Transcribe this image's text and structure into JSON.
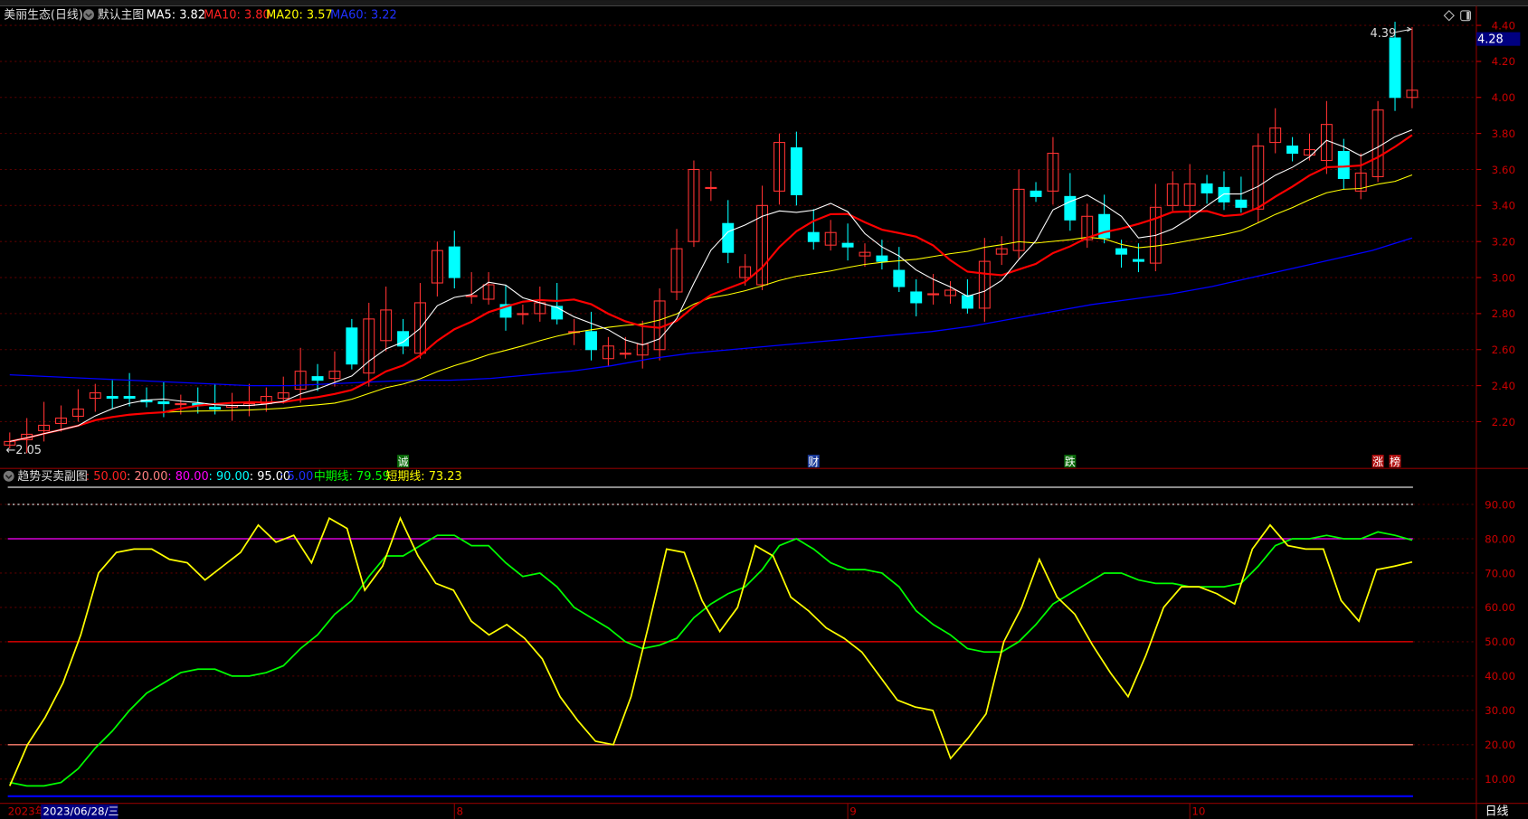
{
  "header": {
    "stock_name": "美丽生态(日线)",
    "main_chart_label": "默认主图",
    "ma5": "MA5: 3.82",
    "ma10": "MA10: 3.80",
    "ma20": "MA20: 3.57",
    "ma60": "MA60: 3.22"
  },
  "sub_header": {
    "label": "趋势买卖副图",
    "p1": ": 50.00",
    "p2": ": 20.00",
    "p3": ": 80.00",
    "p4": ": 90.00",
    "p5": ": 95.00",
    "p6": ": 5.00",
    "mid": "中期线: 79.59",
    "short": "短期线: 73.23"
  },
  "colors": {
    "up": "#ff3232",
    "down": "#00ffff",
    "ma5": "#ffffff",
    "ma10": "#ff0000",
    "ma20": "#ffff00",
    "ma60": "#0000ff",
    "mid": "#00ff00",
    "short": "#ffff00"
  },
  "price_axis": [
    "4.40",
    "4.20",
    "4.00",
    "3.80",
    "3.60",
    "3.40",
    "3.20",
    "3.00",
    "2.80",
    "2.60",
    "2.40",
    "2.20"
  ],
  "current_price": "4.28",
  "high_label": "4.39",
  "low_label": "←2.05",
  "sub_axis": [
    "90.00",
    "80.00",
    "70.00",
    "60.00",
    "50.00",
    "40.00",
    "30.00",
    "20.00",
    "10.00"
  ],
  "markers": [
    {
      "i": 23,
      "t": "诚",
      "bg": "#0a6b0a"
    },
    {
      "i": 47,
      "t": "财",
      "bg": "#1a3a9a"
    },
    {
      "i": 62,
      "t": "跌",
      "bg": "#0a6b0a"
    },
    {
      "i": 80,
      "t": "涨",
      "bg": "#b01010"
    },
    {
      "i": 81,
      "t": "榜",
      "bg": "#b01010"
    }
  ],
  "date_axis": {
    "year": "2023年",
    "selected": "2023/06/28/三",
    "months": [
      {
        "i": 26,
        "t": "8"
      },
      {
        "i": 49,
        "t": "9"
      },
      {
        "i": 69,
        "t": "10"
      }
    ],
    "period": "日线"
  },
  "chart_data": {
    "type": "candlestick",
    "price_range": [
      2.0,
      4.45
    ],
    "candles": [
      [
        2.07,
        2.09
      ],
      [
        2.1,
        2.13
      ],
      [
        2.15,
        2.18
      ],
      [
        2.19,
        2.22
      ],
      [
        2.23,
        2.27
      ],
      [
        2.33,
        2.36
      ],
      [
        2.34,
        2.33
      ],
      [
        2.34,
        2.33
      ],
      [
        2.32,
        2.31
      ],
      [
        2.31,
        2.3
      ],
      [
        2.3,
        2.3
      ],
      [
        2.3,
        2.29
      ],
      [
        2.28,
        2.27
      ],
      [
        2.28,
        2.29
      ],
      [
        2.29,
        2.3
      ],
      [
        2.3,
        2.34
      ],
      [
        2.33,
        2.36
      ],
      [
        2.38,
        2.48
      ],
      [
        2.45,
        2.43
      ],
      [
        2.44,
        2.48
      ],
      [
        2.72,
        2.52
      ],
      [
        2.47,
        2.77
      ],
      [
        2.65,
        2.82
      ],
      [
        2.7,
        2.62
      ],
      [
        2.58,
        2.86
      ],
      [
        2.97,
        3.15
      ],
      [
        3.17,
        3.0
      ],
      [
        2.9,
        2.9
      ],
      [
        2.88,
        2.96
      ],
      [
        2.85,
        2.78
      ],
      [
        2.8,
        2.8
      ],
      [
        2.8,
        2.86
      ],
      [
        2.84,
        2.77
      ],
      [
        2.7,
        2.7
      ],
      [
        2.7,
        2.6
      ],
      [
        2.55,
        2.62
      ],
      [
        2.58,
        2.58
      ],
      [
        2.57,
        2.63
      ],
      [
        2.6,
        2.87
      ],
      [
        2.92,
        3.16
      ],
      [
        3.2,
        3.6
      ],
      [
        3.5,
        3.5
      ],
      [
        3.3,
        3.14
      ],
      [
        3.0,
        3.06
      ],
      [
        2.96,
        3.4
      ],
      [
        3.48,
        3.75
      ],
      [
        3.72,
        3.46
      ],
      [
        3.25,
        3.2
      ],
      [
        3.18,
        3.25
      ],
      [
        3.19,
        3.17
      ],
      [
        3.12,
        3.14
      ],
      [
        3.12,
        3.09
      ],
      [
        3.04,
        2.95
      ],
      [
        2.92,
        2.86
      ],
      [
        2.91,
        2.91
      ],
      [
        2.9,
        2.93
      ],
      [
        2.9,
        2.83
      ],
      [
        2.83,
        3.09
      ],
      [
        3.13,
        3.16
      ],
      [
        3.15,
        3.49
      ],
      [
        3.48,
        3.45
      ],
      [
        3.48,
        3.69
      ],
      [
        3.45,
        3.32
      ],
      [
        3.21,
        3.34
      ],
      [
        3.35,
        3.22
      ],
      [
        3.16,
        3.13
      ],
      [
        3.1,
        3.09
      ],
      [
        3.08,
        3.39
      ],
      [
        3.4,
        3.52
      ],
      [
        3.4,
        3.52
      ],
      [
        3.52,
        3.47
      ],
      [
        3.5,
        3.42
      ],
      [
        3.43,
        3.39
      ],
      [
        3.38,
        3.73
      ],
      [
        3.75,
        3.83
      ],
      [
        3.73,
        3.69
      ],
      [
        3.68,
        3.71
      ],
      [
        3.65,
        3.85
      ],
      [
        3.7,
        3.55
      ],
      [
        3.48,
        3.58
      ],
      [
        3.56,
        3.93
      ],
      [
        4.33,
        4.0
      ],
      [
        4.0,
        4.04
      ]
    ],
    "ma60": [
      2.46,
      2.45,
      2.44,
      2.43,
      2.42,
      2.41,
      2.4,
      2.4,
      2.41,
      2.42,
      2.43,
      2.43,
      2.44,
      2.46,
      2.48,
      2.51,
      2.55,
      2.58,
      2.6,
      2.62,
      2.64,
      2.66,
      2.68,
      2.7,
      2.73,
      2.77,
      2.81,
      2.85,
      2.88,
      2.91,
      2.95,
      3.0,
      3.05,
      3.1,
      3.15,
      3.22
    ],
    "short_line": [
      8,
      20,
      28,
      38,
      52,
      70,
      76,
      77,
      77,
      74,
      73,
      68,
      72,
      76,
      84,
      79,
      81,
      73,
      86,
      83,
      65,
      72,
      86,
      75,
      67,
      65,
      56,
      52,
      55,
      51,
      45,
      34,
      27,
      21,
      20,
      34,
      55,
      77,
      76,
      62,
      53,
      60,
      78,
      75,
      63,
      59,
      54,
      51,
      47,
      40,
      33,
      31,
      30,
      16,
      22,
      29,
      50,
      60,
      74,
      63,
      58,
      49,
      41,
      34,
      46,
      60,
      66,
      66,
      64,
      61,
      77,
      84,
      78,
      77,
      77,
      62,
      56,
      71,
      72,
      73.23
    ],
    "mid_line": [
      9,
      8,
      8,
      9,
      13,
      19,
      24,
      30,
      35,
      38,
      41,
      42,
      42,
      40,
      40,
      41,
      43,
      48,
      52,
      58,
      62,
      69,
      75,
      75,
      78,
      81,
      81,
      78,
      78,
      73,
      69,
      70,
      66,
      60,
      57,
      54,
      50,
      48,
      49,
      51,
      57,
      61,
      64,
      66,
      71,
      78,
      80,
      77,
      73,
      71,
      71,
      70,
      66,
      59,
      55,
      52,
      48,
      47,
      47,
      50,
      55,
      61,
      64,
      67,
      70,
      70,
      68,
      67,
      67,
      66,
      66,
      66,
      67,
      72,
      78,
      80,
      80,
      81,
      80,
      80,
      82,
      81,
      79.59
    ],
    "ref_lines": [
      95,
      90,
      80,
      50,
      20,
      5
    ]
  }
}
